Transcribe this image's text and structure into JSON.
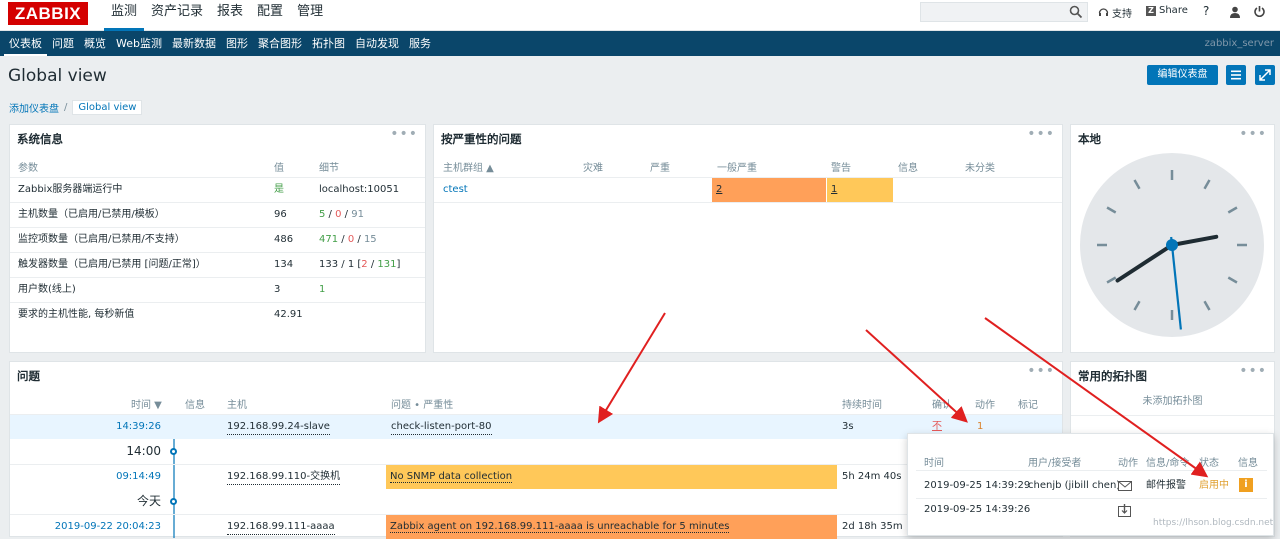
{
  "brand": "ZABBIX",
  "main_menu": [
    "监测",
    "资产记录",
    "报表",
    "配置",
    "管理"
  ],
  "top_right": {
    "support": "支持",
    "share": "Share",
    "help": "?"
  },
  "sub_menu": [
    "仪表板",
    "问题",
    "概览",
    "Web监测",
    "最新数据",
    "图形",
    "聚合图形",
    "拓扑图",
    "自动发现",
    "服务"
  ],
  "server_name": "zabbix_server",
  "page_title": "Global view",
  "edit_button": "编辑仪表盘",
  "breadcrumb": {
    "parent": "添加仪表盘",
    "separator": "/",
    "current": "Global view"
  },
  "sysinfo": {
    "title": "系统信息",
    "headers": [
      "参数",
      "值",
      "细节"
    ],
    "rows": [
      {
        "param": "Zabbix服务器端运行中",
        "value": "是",
        "detail": "localhost:10051"
      },
      {
        "param": "主机数量（已启用/已禁用/模板）",
        "value": "96",
        "d1": "5",
        "s1": " / ",
        "d2": "0",
        "s2": " / ",
        "d3": "91"
      },
      {
        "param": "监控项数量（已启用/已禁用/不支持）",
        "value": "486",
        "d1": "471",
        "s1": " / ",
        "d2": "0",
        "s2": " / ",
        "d3": "15"
      },
      {
        "param": "触发器数量（已启用/已禁用 [问题/正常]）",
        "value": "134",
        "d0": "133 / 1 [",
        "d1": "2",
        "s1": " / ",
        "d2": "131",
        "s2": "]"
      },
      {
        "param": "用户数(线上)",
        "value": "3",
        "d1": "1"
      },
      {
        "param": "要求的主机性能, 每秒新值",
        "value": "42.91"
      }
    ]
  },
  "severity": {
    "title": "按严重性的问题",
    "headers": [
      "主机群组 ▲",
      "灾难",
      "严重",
      "一般严重",
      "警告",
      "信息",
      "未分类"
    ],
    "row": {
      "group": "ctest",
      "average": "2",
      "warning": "1"
    }
  },
  "clock": {
    "title": "本地",
    "hour": 2,
    "minute": 39,
    "second": 29
  },
  "problems": {
    "title": "问题",
    "headers": {
      "time": "时间 ▼",
      "info": "信息",
      "host": "主机",
      "problem": "问题 • 严重性",
      "duration": "持续时间",
      "ack": "确认",
      "actions": "动作",
      "tags": "标记"
    },
    "rows": [
      {
        "time": "14:39:26",
        "host": "192.168.99.24-slave",
        "problem": "check-listen-port-80",
        "duration": "3s",
        "ack": "不",
        "actions": "1"
      },
      {
        "divider": "14:00"
      },
      {
        "time": "09:14:49",
        "host": "192.168.99.110-交换机",
        "problem": "No SNMP data collection",
        "duration": "5h 24m 40s"
      },
      {
        "divider": "今天"
      },
      {
        "time": "2019-09-22 20:04:23",
        "host": "192.168.99.111-aaaa",
        "problem": "Zabbix agent on 192.168.99.111-aaaa is unreachable for 5 minutes",
        "duration": "2d 18h 35m"
      }
    ]
  },
  "maps": {
    "title": "常用的拓扑图",
    "empty": "未添加拓扑图"
  },
  "action_popup": {
    "headers": [
      "时间",
      "用户/接受者",
      "动作",
      "信息/命令",
      "状态",
      "信息"
    ],
    "rows": [
      {
        "time": "2019-09-25 14:39:29",
        "user": "chenjb (jibill chen)",
        "message": "邮件报警",
        "status": "启用中",
        "info": "i"
      },
      {
        "time": "2019-09-25 14:39:26"
      }
    ]
  },
  "watermark": "https://lhson.blog.csdn.net",
  "colors": {
    "brand_red": "#d40000",
    "nav_dark": "#0a466a",
    "link_blue": "#0275b8",
    "average": "#ffa059",
    "warning": "#ffc859",
    "arrow": "#e02020"
  }
}
